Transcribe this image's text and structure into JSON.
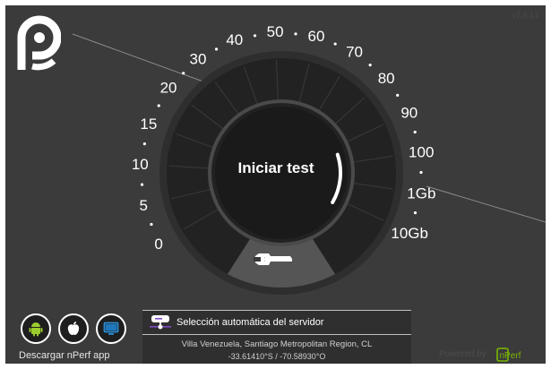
{
  "version": "v2.6.14",
  "start_button": {
    "label": "Iniciar test"
  },
  "gauge": {
    "labels": [
      "0",
      "5",
      "10",
      "15",
      "20",
      "30",
      "40",
      "50",
      "60",
      "70",
      "80",
      "90",
      "100",
      "1Gb",
      "10Gb"
    ]
  },
  "apps": {
    "label": "Descargar nPerf app",
    "items": [
      {
        "name": "android",
        "icon": "android-icon"
      },
      {
        "name": "apple",
        "icon": "apple-icon"
      },
      {
        "name": "desktop",
        "icon": "monitor-icon"
      }
    ]
  },
  "server": {
    "title": "Selección automática del servidor",
    "location": "Villa Venezuela, Santiago Metropolitan Region, CL",
    "coordinates": "-33.61410°S / -70.58930°O"
  },
  "footer": {
    "powered_by": "Powered by",
    "brand": "nPerf"
  },
  "colors": {
    "background": "#3b3b3b",
    "gauge_body": "#222222",
    "accent": "#ffffff",
    "brand_green": "#7ab800"
  }
}
